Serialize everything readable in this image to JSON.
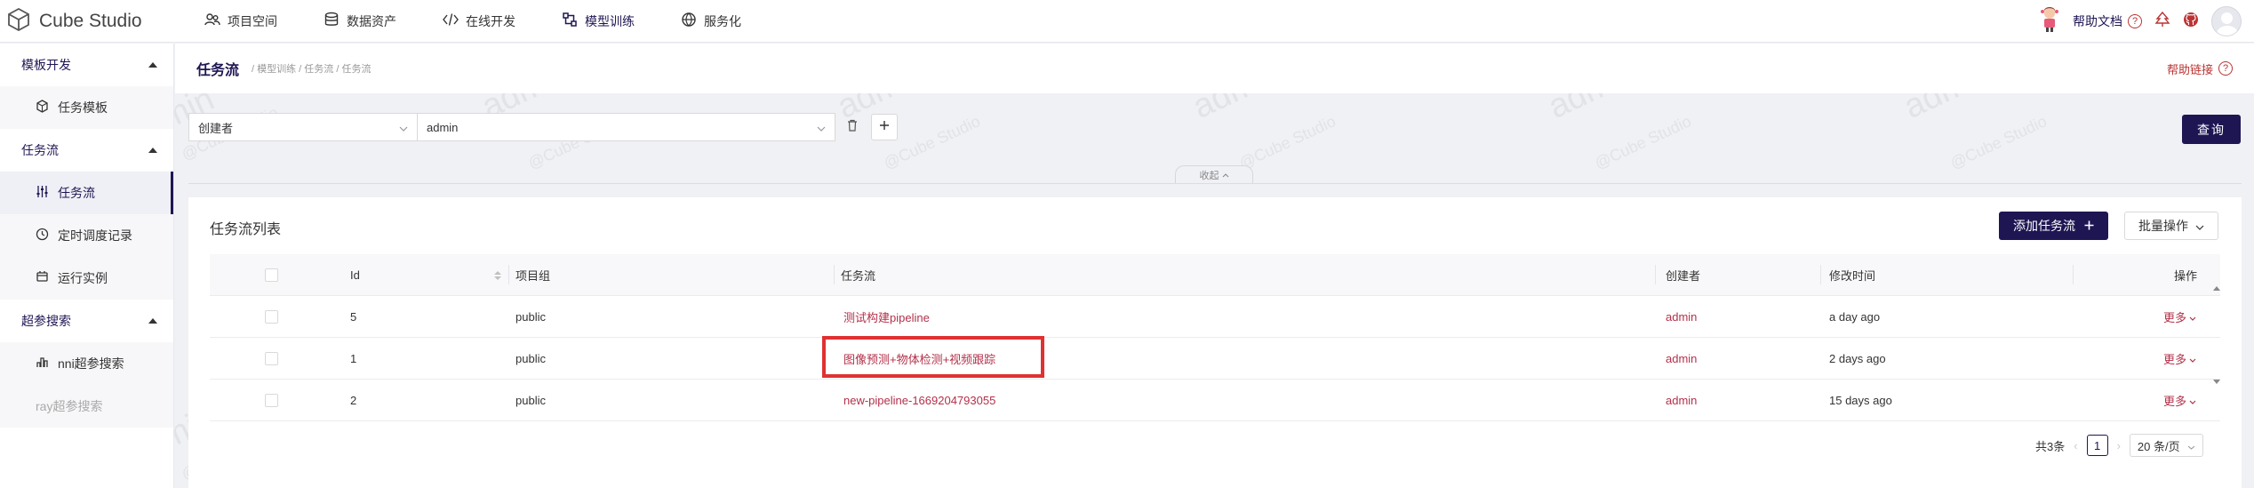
{
  "app": {
    "name": "Cube Studio"
  },
  "nav": [
    {
      "label": "项目空间",
      "icon": "team-icon"
    },
    {
      "label": "数据资产",
      "icon": "database-icon"
    },
    {
      "label": "在线开发",
      "icon": "code-icon"
    },
    {
      "label": "模型训练",
      "icon": "model-icon",
      "active": true
    },
    {
      "label": "服务化",
      "icon": "service-icon"
    }
  ],
  "header": {
    "help_docs": "帮助文档"
  },
  "sidebar": {
    "groups": [
      {
        "label": "模板开发",
        "items": [
          {
            "label": "任务模板",
            "icon": "template-icon"
          }
        ]
      },
      {
        "label": "任务流",
        "items": [
          {
            "label": "任务流",
            "icon": "sliders-icon",
            "active": true
          },
          {
            "label": "定时调度记录",
            "icon": "clock-icon"
          },
          {
            "label": "运行实例",
            "icon": "instance-icon"
          }
        ]
      },
      {
        "label": "超参搜索",
        "items": [
          {
            "label": "nni超参搜索",
            "icon": "nni-icon"
          },
          {
            "label": "ray超参搜索",
            "icon": "ray-icon",
            "disabled": true
          }
        ]
      }
    ]
  },
  "page": {
    "title": "任务流",
    "breadcrumb": "/ 模型训练 / 任务流 / 任务流",
    "help_link": "帮助链接"
  },
  "filter": {
    "field": "创建者",
    "value": "admin",
    "query_label": "查询",
    "collapse_label": "收起"
  },
  "table": {
    "title": "任务流列表",
    "add_label": "添加任务流",
    "batch_label": "批量操作",
    "columns": {
      "id": "Id",
      "project": "项目组",
      "pipeline": "任务流",
      "creator": "创建者",
      "modified": "修改时间",
      "actions": "操作"
    },
    "rows": [
      {
        "id": "5",
        "project": "public",
        "pipeline": "测试构建pipeline",
        "creator": "admin",
        "modified": "a day ago",
        "more": "更多"
      },
      {
        "id": "1",
        "project": "public",
        "pipeline": "图像预测+物体检测+视频跟踪",
        "creator": "admin",
        "modified": "2 days ago",
        "more": "更多"
      },
      {
        "id": "2",
        "project": "public",
        "pipeline": "new-pipeline-1669204793055",
        "creator": "admin",
        "modified": "15 days ago",
        "more": "更多"
      }
    ]
  },
  "pagination": {
    "total": "共3条",
    "current": "1",
    "page_size": "20 条/页"
  },
  "watermark": {
    "main": "admin",
    "sub": "@Cube Studio"
  },
  "colors": {
    "brand": "#1e1653",
    "link": "#b3304a",
    "highlight": "#e03131"
  }
}
